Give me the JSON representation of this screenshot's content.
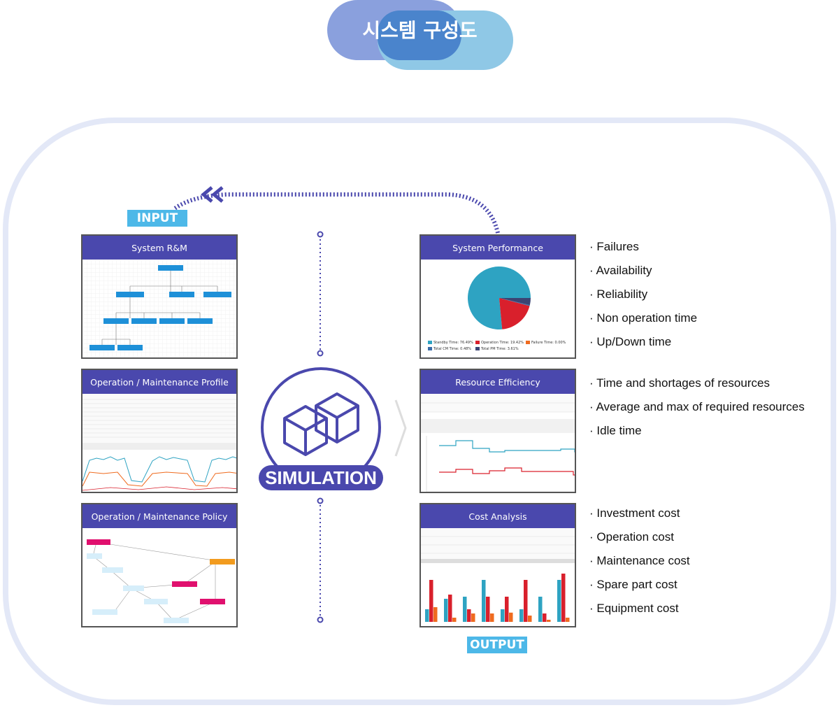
{
  "title": "시스템 구성도",
  "colors": {
    "panel_header": "#4a48ad",
    "tag": "#4db8e8",
    "pill_left": "#8aa0dd",
    "pill_right": "#8fc8e6",
    "frame": "#e3e8f7"
  },
  "input_label": "INPUT",
  "output_label": "OUTPUT",
  "simulation_label": "SIMULATION",
  "inputs": [
    {
      "title": "System R&M"
    },
    {
      "title": "Operation / Maintenance Profile"
    },
    {
      "title": "Operation / Maintenance Policy"
    }
  ],
  "outputs": [
    {
      "title": "System Performance",
      "bullets": [
        "Failures",
        "Availability",
        "Reliability",
        "Non operation time",
        "Up/Down time"
      ],
      "pie": {
        "slices": [
          {
            "label": "Standby Time: 76.49%",
            "value": 76.49,
            "color": "#2ea3c2"
          },
          {
            "label": "Operation Time: 19.42%",
            "value": 19.42,
            "color": "#d9202c"
          },
          {
            "label": "Failure Time: 0.00%",
            "value": 0.0,
            "color": "#ef6b1f"
          },
          {
            "label": "Total CM Time: 0.48%",
            "value": 0.48,
            "color": "#3a6ca8"
          },
          {
            "label": "Total PM Time: 3.61%",
            "value": 3.61,
            "color": "#3b4473"
          }
        ]
      }
    },
    {
      "title": "Resource Efficiency",
      "bullets": [
        "Time and shortages of resources",
        "Average and max of required resources",
        "Idle time"
      ]
    },
    {
      "title": "Cost Analysis",
      "bullets": [
        "Investment cost",
        "Operation cost",
        "Maintenance cost",
        "Spare part cost",
        "Equipment cost"
      ]
    }
  ]
}
